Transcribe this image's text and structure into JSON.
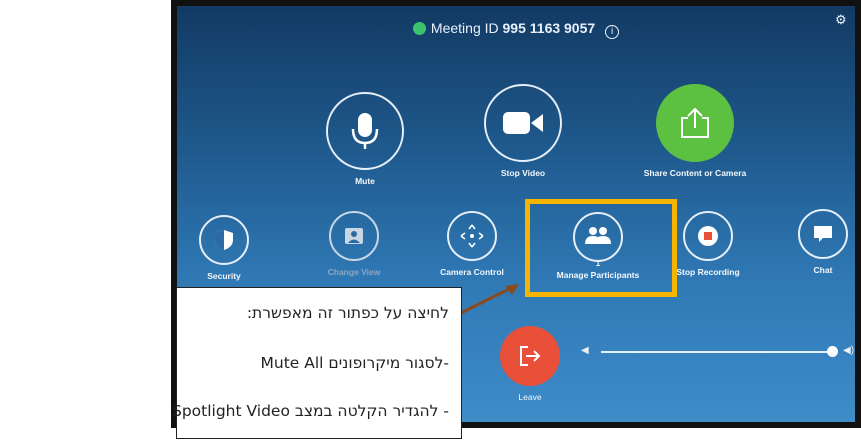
{
  "meeting": {
    "label": "Meeting ID",
    "id": "995 1163 9057"
  },
  "controls": {
    "mute": "Mute",
    "stop_video": "Stop Video",
    "share": "Share Content or Camera",
    "security": "Security",
    "change_view": "Change View",
    "camera_control": "Camera Control",
    "manage_participants": "Manage Participants",
    "participant_count": "1",
    "stop_recording": "Stop Recording",
    "chat": "Chat",
    "leave": "Leave"
  },
  "volume": {
    "level": 0.98
  },
  "callout": {
    "line1": "לחיצה על כפתור זה מאפשרת:",
    "line2": "-לסגור מיקרופונים Mute All",
    "line3": "- להגדיר הקלטה במצב Spotlight Video"
  },
  "colors": {
    "highlight": "#f4b400",
    "share": "#5cc141",
    "leave": "#e9503a",
    "background": "#1f5a8e"
  }
}
